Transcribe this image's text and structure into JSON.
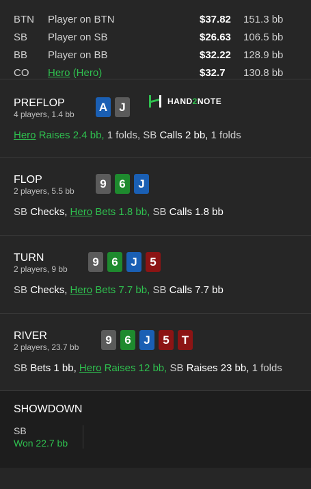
{
  "players": [
    {
      "pos": "BTN",
      "name": "Player on BTN",
      "stack": "$37.82",
      "bb": "151.3 bb"
    },
    {
      "pos": "SB",
      "name": "Player on SB",
      "stack": "$26.63",
      "bb": "106.5 bb"
    },
    {
      "pos": "BB",
      "name": "Player on BB",
      "stack": "$32.22",
      "bb": "128.9 bb"
    },
    {
      "pos": "CO",
      "name": "Hero",
      "tag": "(Hero)",
      "stack": "$32.7",
      "bb": "130.8 bb"
    }
  ],
  "streets": {
    "preflop": {
      "title": "PREFLOP",
      "sub": "4 players, 1.4 bb",
      "cards": [
        {
          "r": "A",
          "color": "#1a5fb4"
        },
        {
          "r": "J",
          "color": "#5b5b5b"
        }
      ],
      "a1": "Hero",
      "a2": "Raises 2.4 bb,",
      "a3": "1 folds, SB",
      "a4": "Calls 2 bb,",
      "a5": "1 folds"
    },
    "flop": {
      "title": "FLOP",
      "sub": "2 players, 5.5 bb",
      "cards": [
        {
          "r": "9",
          "color": "#5b5b5b"
        },
        {
          "r": "6",
          "color": "#1e8a2e"
        },
        {
          "r": "J",
          "color": "#1a5fb4"
        }
      ],
      "a1": "SB",
      "a2": "Checks,",
      "a3": "Hero",
      "a4": "Bets 1.8 bb,",
      "a5": "SB",
      "a6": "Calls 1.8 bb"
    },
    "turn": {
      "title": "TURN",
      "sub": "2 players, 9 bb",
      "cards": [
        {
          "r": "9",
          "color": "#5b5b5b"
        },
        {
          "r": "6",
          "color": "#1e8a2e"
        },
        {
          "r": "J",
          "color": "#1a5fb4"
        },
        {
          "r": "5",
          "color": "#8c1414"
        }
      ],
      "a1": "SB",
      "a2": "Checks,",
      "a3": "Hero",
      "a4": "Bets 7.7 bb,",
      "a5": "SB",
      "a6": "Calls 7.7 bb"
    },
    "river": {
      "title": "RIVER",
      "sub": "2 players, 23.7 bb",
      "cards": [
        {
          "r": "9",
          "color": "#5b5b5b"
        },
        {
          "r": "6",
          "color": "#1e8a2e"
        },
        {
          "r": "J",
          "color": "#1a5fb4"
        },
        {
          "r": "5",
          "color": "#8c1414"
        },
        {
          "r": "T",
          "color": "#8c1414"
        }
      ],
      "a1": "SB",
      "a2": "Bets 1 bb,",
      "a3": "Hero",
      "a4": "Raises 12 bb,",
      "a5": "SB",
      "a6": "Raises 23 bb,",
      "a7": "1 folds"
    }
  },
  "logo": {
    "part1": "HAND",
    "part2": "2",
    "part3": "NOTE"
  },
  "showdown": {
    "title": "SHOWDOWN",
    "pos": "SB",
    "result": "Won 22.7 bb"
  },
  "colors": {
    "hero": "#2fc04f",
    "bg": "#262626"
  }
}
